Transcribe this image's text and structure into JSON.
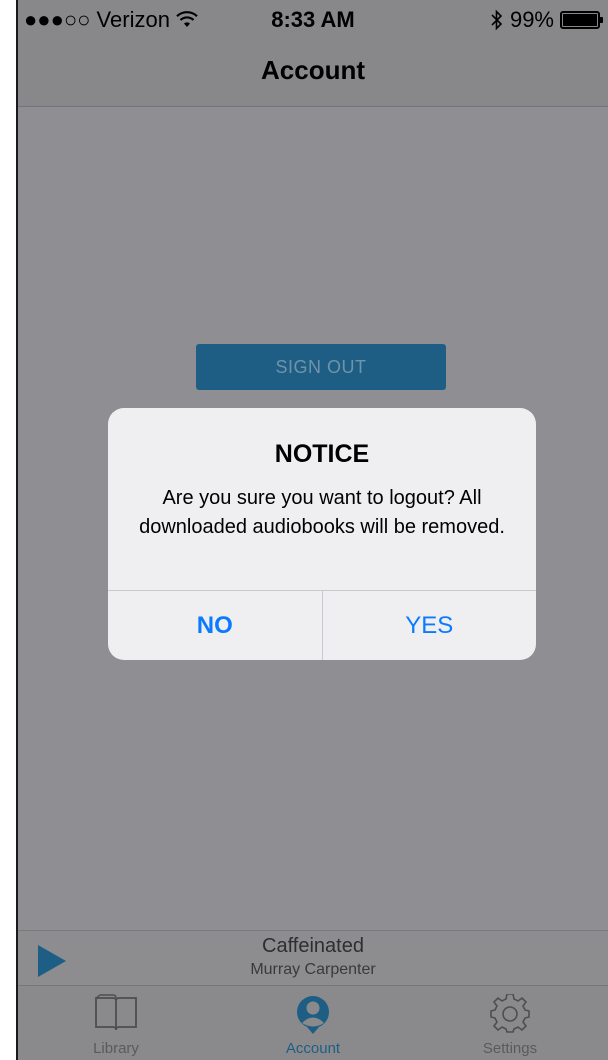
{
  "status_bar": {
    "carrier": "●●●○○ Verizon",
    "time": "8:33 AM",
    "battery_percent": "99%",
    "battery_level": 0.99
  },
  "nav": {
    "title": "Account"
  },
  "account": {
    "sign_out_label": "SIGN OUT"
  },
  "alert": {
    "title": "NOTICE",
    "message": "Are you sure you want to logout? All downloaded audiobooks will be removed.",
    "no_label": "NO",
    "yes_label": "YES"
  },
  "player": {
    "title": "Caffeinated",
    "artist": "Murray Carpenter"
  },
  "tabs": [
    {
      "label": "Library",
      "icon": "book-icon",
      "active": false
    },
    {
      "label": "Account",
      "icon": "user-icon",
      "active": true
    },
    {
      "label": "Settings",
      "icon": "gear-icon",
      "active": false
    }
  ],
  "colors": {
    "accent": "#1f5e84",
    "link": "#0a7bff",
    "overlay": "#8f8e93"
  }
}
